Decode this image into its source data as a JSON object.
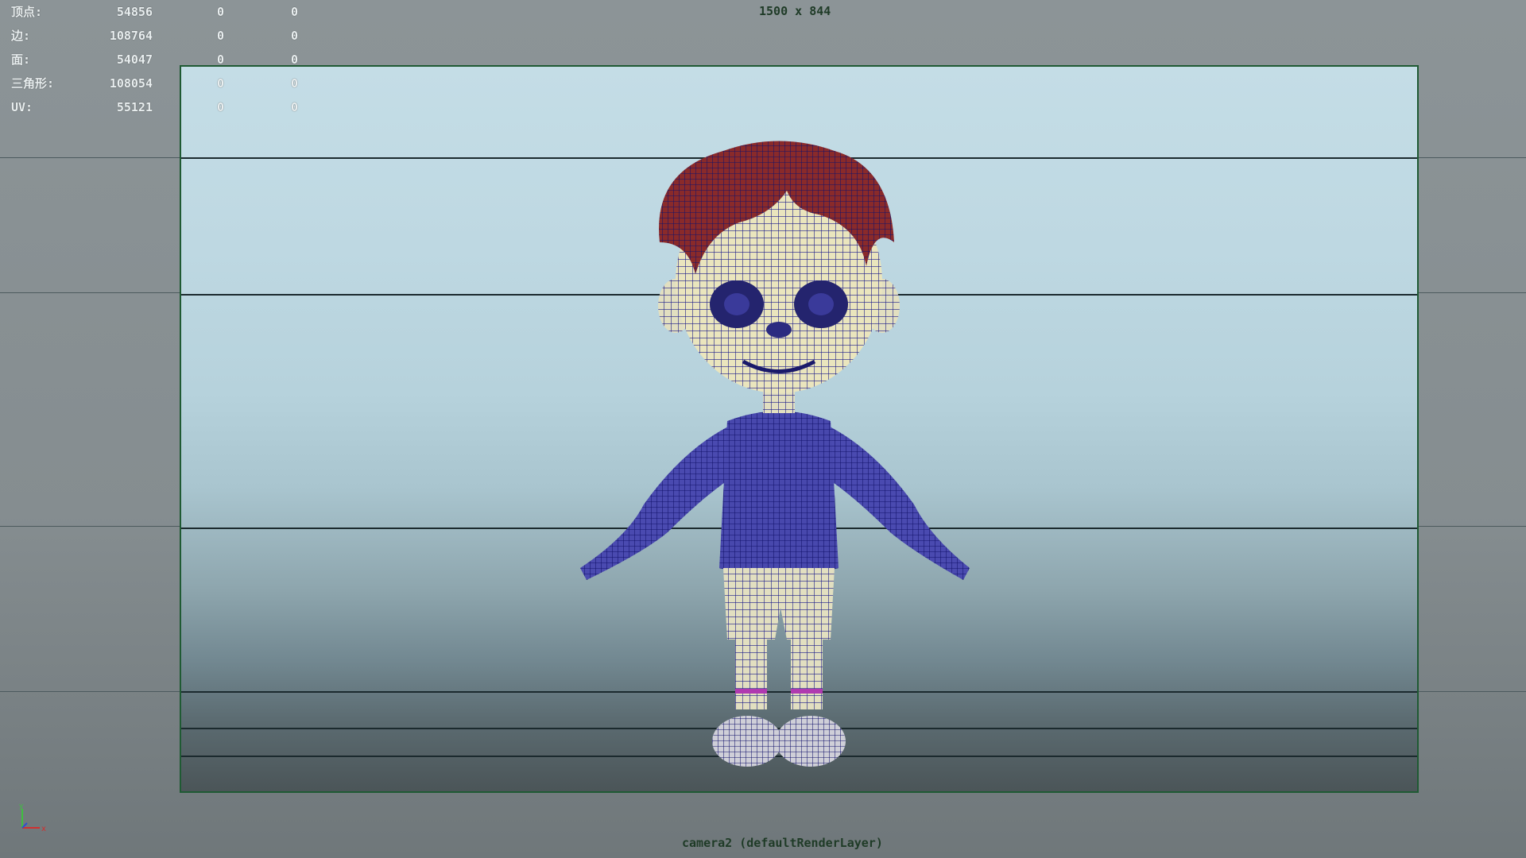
{
  "hud": {
    "rows": [
      {
        "label": "顶点:",
        "total": "54856",
        "selected": "0",
        "triangles": "0"
      },
      {
        "label": "边:",
        "total": "108764",
        "selected": "0",
        "triangles": "0"
      },
      {
        "label": "面:",
        "total": "54047",
        "selected": "0",
        "triangles": "0"
      },
      {
        "label": "三角形:",
        "total": "108054",
        "selected": "0",
        "triangles": "0"
      },
      {
        "label": "UV:",
        "total": "55121",
        "selected": "0",
        "triangles": "0"
      }
    ]
  },
  "viewport": {
    "resolution": "1500 x 844",
    "camera": "camera2 (defaultRenderLayer)"
  },
  "colors": {
    "gate_border": "#1f5a33",
    "wireframe": "#1a1a8a",
    "hair": "#8a2a2a",
    "skin": "#e8e4b8"
  },
  "icons": {
    "axis": "axis-gizmo-icon",
    "model": "character-wireframe"
  }
}
